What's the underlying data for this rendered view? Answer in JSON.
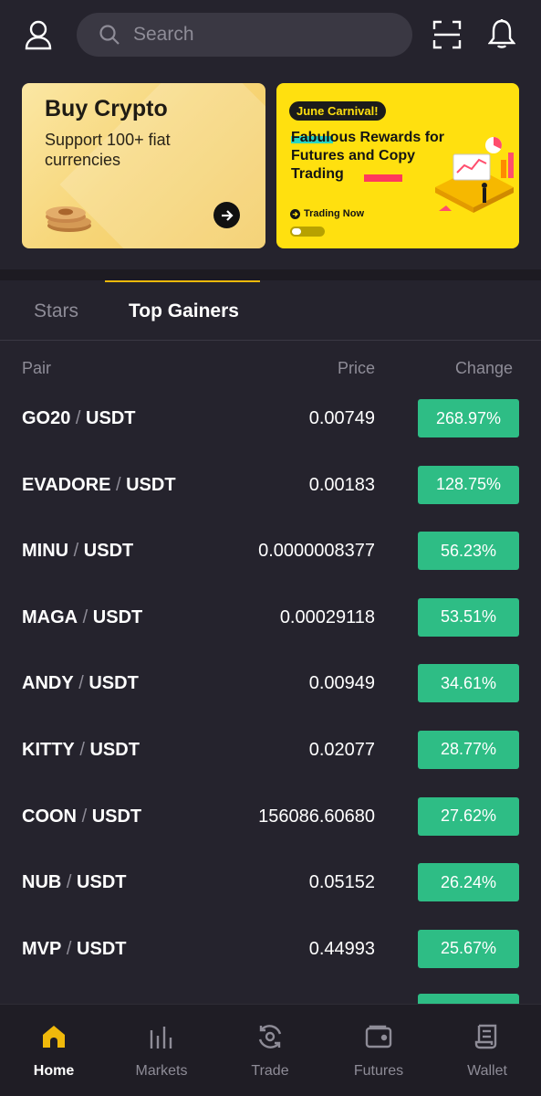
{
  "search": {
    "placeholder": "Search"
  },
  "banners": {
    "buy_crypto": {
      "title": "Buy Crypto",
      "subtitle": "Support 100+ fiat currencies"
    },
    "promo": {
      "badge": "June Carnival!",
      "title": "Fabulous Rewards for Futures and Copy Trading",
      "cta": "Trading Now",
      "carousel_progress": 0.3
    }
  },
  "tabs": [
    {
      "label": "Stars",
      "active": false
    },
    {
      "label": "Top Gainers",
      "active": true
    }
  ],
  "table": {
    "headers": {
      "pair": "Pair",
      "price": "Price",
      "change": "Change"
    },
    "rows": [
      {
        "base": "GO20",
        "sep": "/",
        "quote": "USDT",
        "price": "0.00749",
        "change": "268.97%"
      },
      {
        "base": "EVADORE",
        "sep": "/",
        "quote": "USDT",
        "price": "0.00183",
        "change": "128.75%"
      },
      {
        "base": "MINU",
        "sep": "/",
        "quote": "USDT",
        "price": "0.0000008377",
        "change": "56.23%"
      },
      {
        "base": "MAGA",
        "sep": "/",
        "quote": "USDT",
        "price": "0.00029118",
        "change": "53.51%"
      },
      {
        "base": "ANDY",
        "sep": "/",
        "quote": "USDT",
        "price": "0.00949",
        "change": "34.61%"
      },
      {
        "base": "KITTY",
        "sep": "/",
        "quote": "USDT",
        "price": "0.02077",
        "change": "28.77%"
      },
      {
        "base": "COON",
        "sep": "/",
        "quote": "USDT",
        "price": "156086.60680",
        "change": "27.62%"
      },
      {
        "base": "NUB",
        "sep": "/",
        "quote": "USDT",
        "price": "0.05152",
        "change": "26.24%"
      },
      {
        "base": "MVP",
        "sep": "/",
        "quote": "USDT",
        "price": "0.44993",
        "change": "25.67%"
      }
    ]
  },
  "nav": [
    {
      "label": "Home",
      "icon": "home-icon",
      "active": true
    },
    {
      "label": "Markets",
      "icon": "markets-icon",
      "active": false
    },
    {
      "label": "Trade",
      "icon": "trade-icon",
      "active": false
    },
    {
      "label": "Futures",
      "icon": "futures-icon",
      "active": false
    },
    {
      "label": "Wallet",
      "icon": "wallet-icon",
      "active": false
    }
  ],
  "colors": {
    "background": "#25232d",
    "accent": "#f0b90b",
    "positive": "#2ebd85",
    "muted_text": "#8e8c97"
  }
}
